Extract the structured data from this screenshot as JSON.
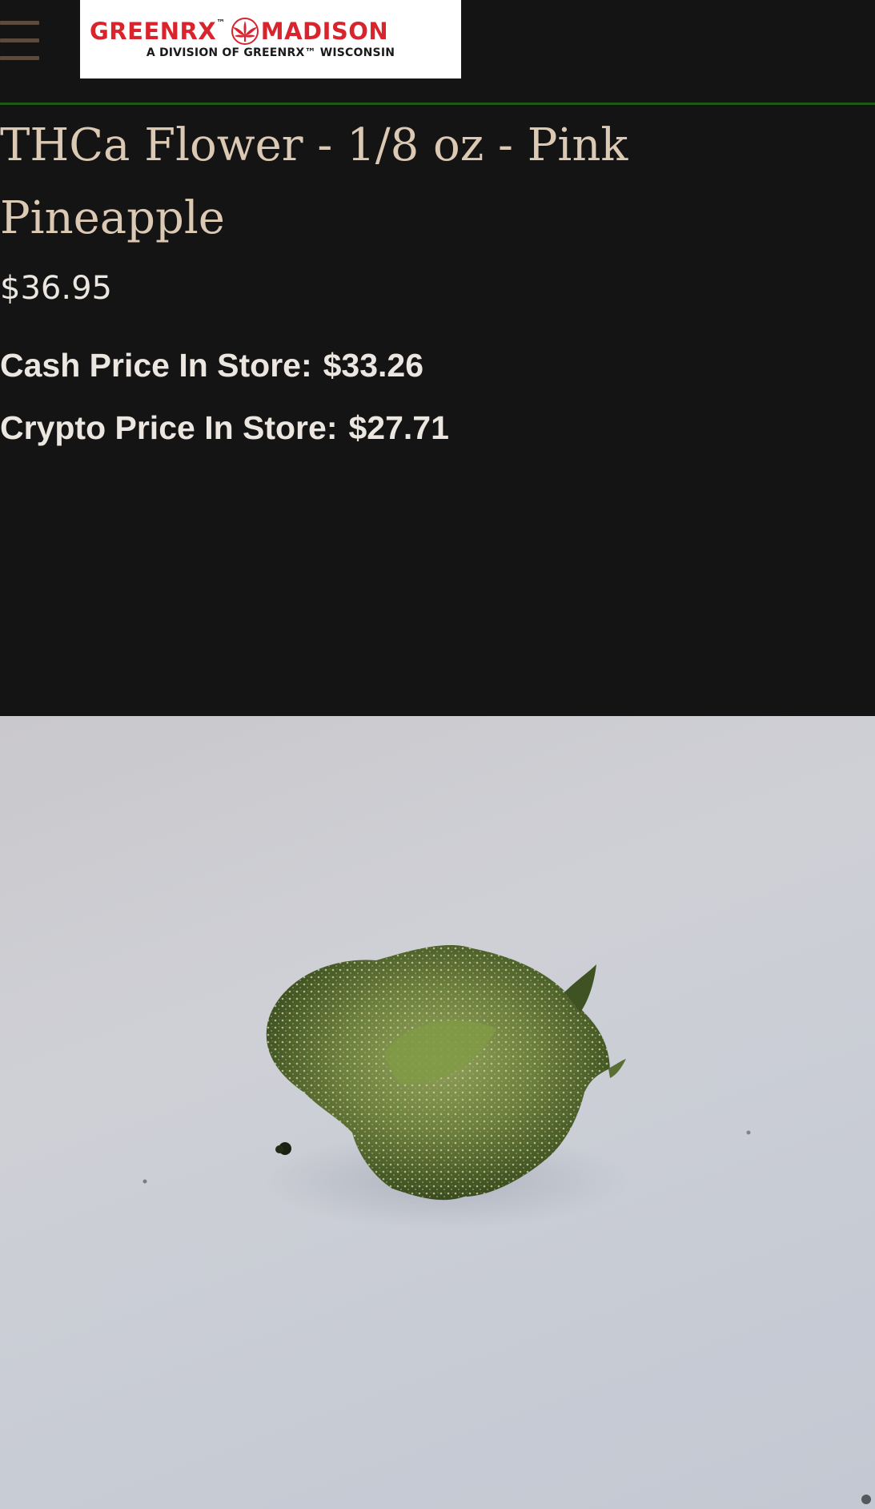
{
  "header": {
    "menu_icon": "hamburger-menu-icon",
    "logo": {
      "brand": "GREENRX",
      "trademark": "™",
      "location": "MADISON",
      "tagline": "A DIVISION OF GREENRX™ WISCONSIN",
      "emblem_icon": "cannabis-leaf-icon"
    },
    "divider_color": "#1f5a12"
  },
  "product": {
    "title": "THCa Flower - 1/8 oz - Pink Pineapple",
    "price": "$36.95",
    "cash_price": {
      "label": "Cash Price In Store:",
      "value": "$33.26"
    },
    "crypto_price": {
      "label": "Crypto Price In Store:",
      "value": "$27.71"
    },
    "image_subject": "cannabis-flower-bud-photo"
  },
  "colors": {
    "background": "#141415",
    "title": "#dcc9b3",
    "text": "#ebe6e0",
    "brand_red": "#d9232d"
  }
}
